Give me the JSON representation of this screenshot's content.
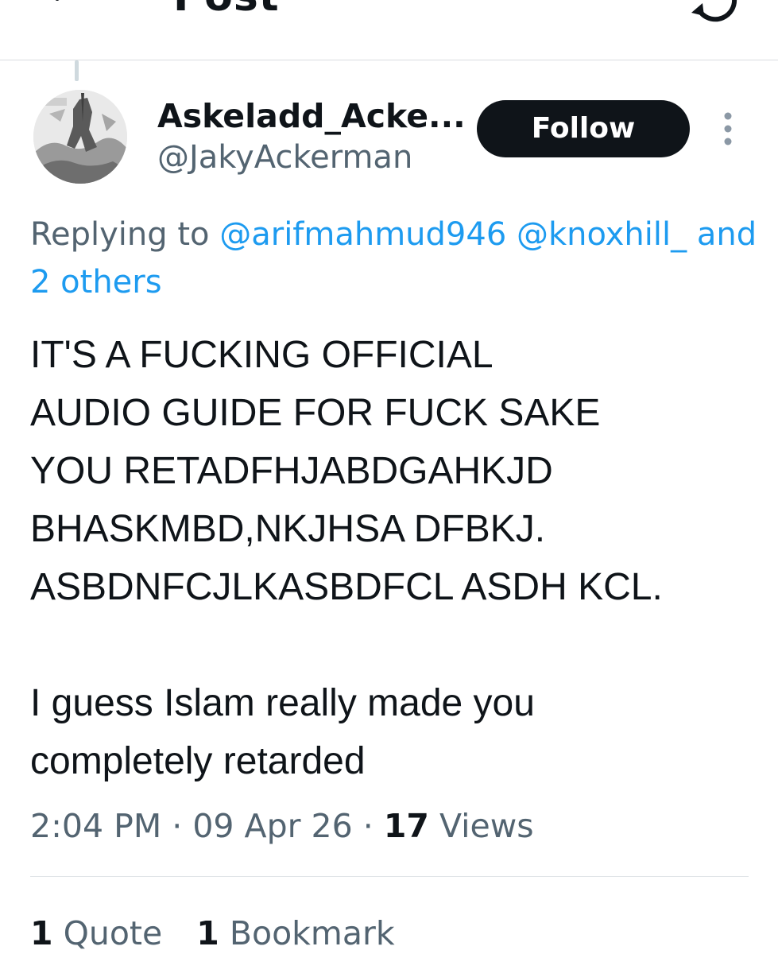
{
  "header": {
    "title": "Post",
    "back_icon": "arrow-left-icon",
    "refresh_icon": "refresh-icon"
  },
  "author": {
    "display_name": "Askeladd_Acke...",
    "handle": "@JakyAckerman",
    "avatar": "avatar-image"
  },
  "follow_label": "Follow",
  "more_icon": "more-vertical-icon",
  "reply_context": {
    "prefix": "Replying to",
    "mentions": [
      "@arifmahmud946",
      "@knoxhill_"
    ],
    "connector": "and",
    "others": "2 others"
  },
  "post": {
    "text": "IT'S A FUCKING OFFICIAL\nAUDIO GUIDE  FOR FUCK SAKE\nYOU RETADFHJABDGAHKJD\nBHASKMBD,NKJHSA DFBKJ.\nASBDNFCJLKASBDFCL ASDH KCL.\n\nI guess Islam really made you\ncompletely retarded",
    "time": "2:04 PM",
    "date": "09 Apr 26",
    "views_count": "17",
    "views_label": "Views",
    "separator": "·"
  },
  "stats": {
    "quotes_count": "1",
    "quotes_label": "Quote",
    "bookmarks_count": "1",
    "bookmarks_label": "Bookmark"
  },
  "colors": {
    "text": "#0f1419",
    "secondary": "#536471",
    "link": "#1d9bf0",
    "button_bg": "#0f1419"
  }
}
